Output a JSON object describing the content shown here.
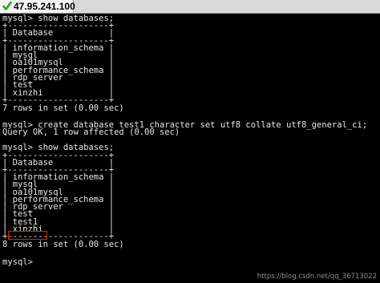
{
  "window": {
    "tab_title": "47.95.241.100",
    "tab_icon": "checkmark-icon",
    "tab_icon_color": "#2e9e2e"
  },
  "terminal": {
    "foreground": "#e6e6e6",
    "background": "#000000",
    "lines": [
      "mysql> show databases;",
      "+--------------------+",
      "| Database           |",
      "+--------------------+",
      "| information_schema |",
      "| mysql              |",
      "| oa101mysql         |",
      "| performance_schema |",
      "| rdp_server         |",
      "| test               |",
      "| xinzhi             |",
      "+--------------------+",
      "7 rows in set (0.00 sec)",
      "",
      "mysql> create database test1 character set utf8 collate utf8_general_ci;",
      "Query OK, 1 row affected (0.00 sec)",
      "",
      "mysql> show databases;",
      "+--------------------+",
      "| Database           |",
      "+--------------------+",
      "| information_schema |",
      "| mysql              |",
      "| oa101mysql         |",
      "| performance_schema |",
      "| rdp_server         |",
      "| test               |",
      "| test1              |",
      "| xinzhi             |",
      "+--------------------+",
      "8 rows in set (0.00 sec)",
      "",
      "mysql> "
    ],
    "highlight_color": "#e31b1b"
  },
  "watermark": "https://blog.csdn.net/qq_36713022"
}
